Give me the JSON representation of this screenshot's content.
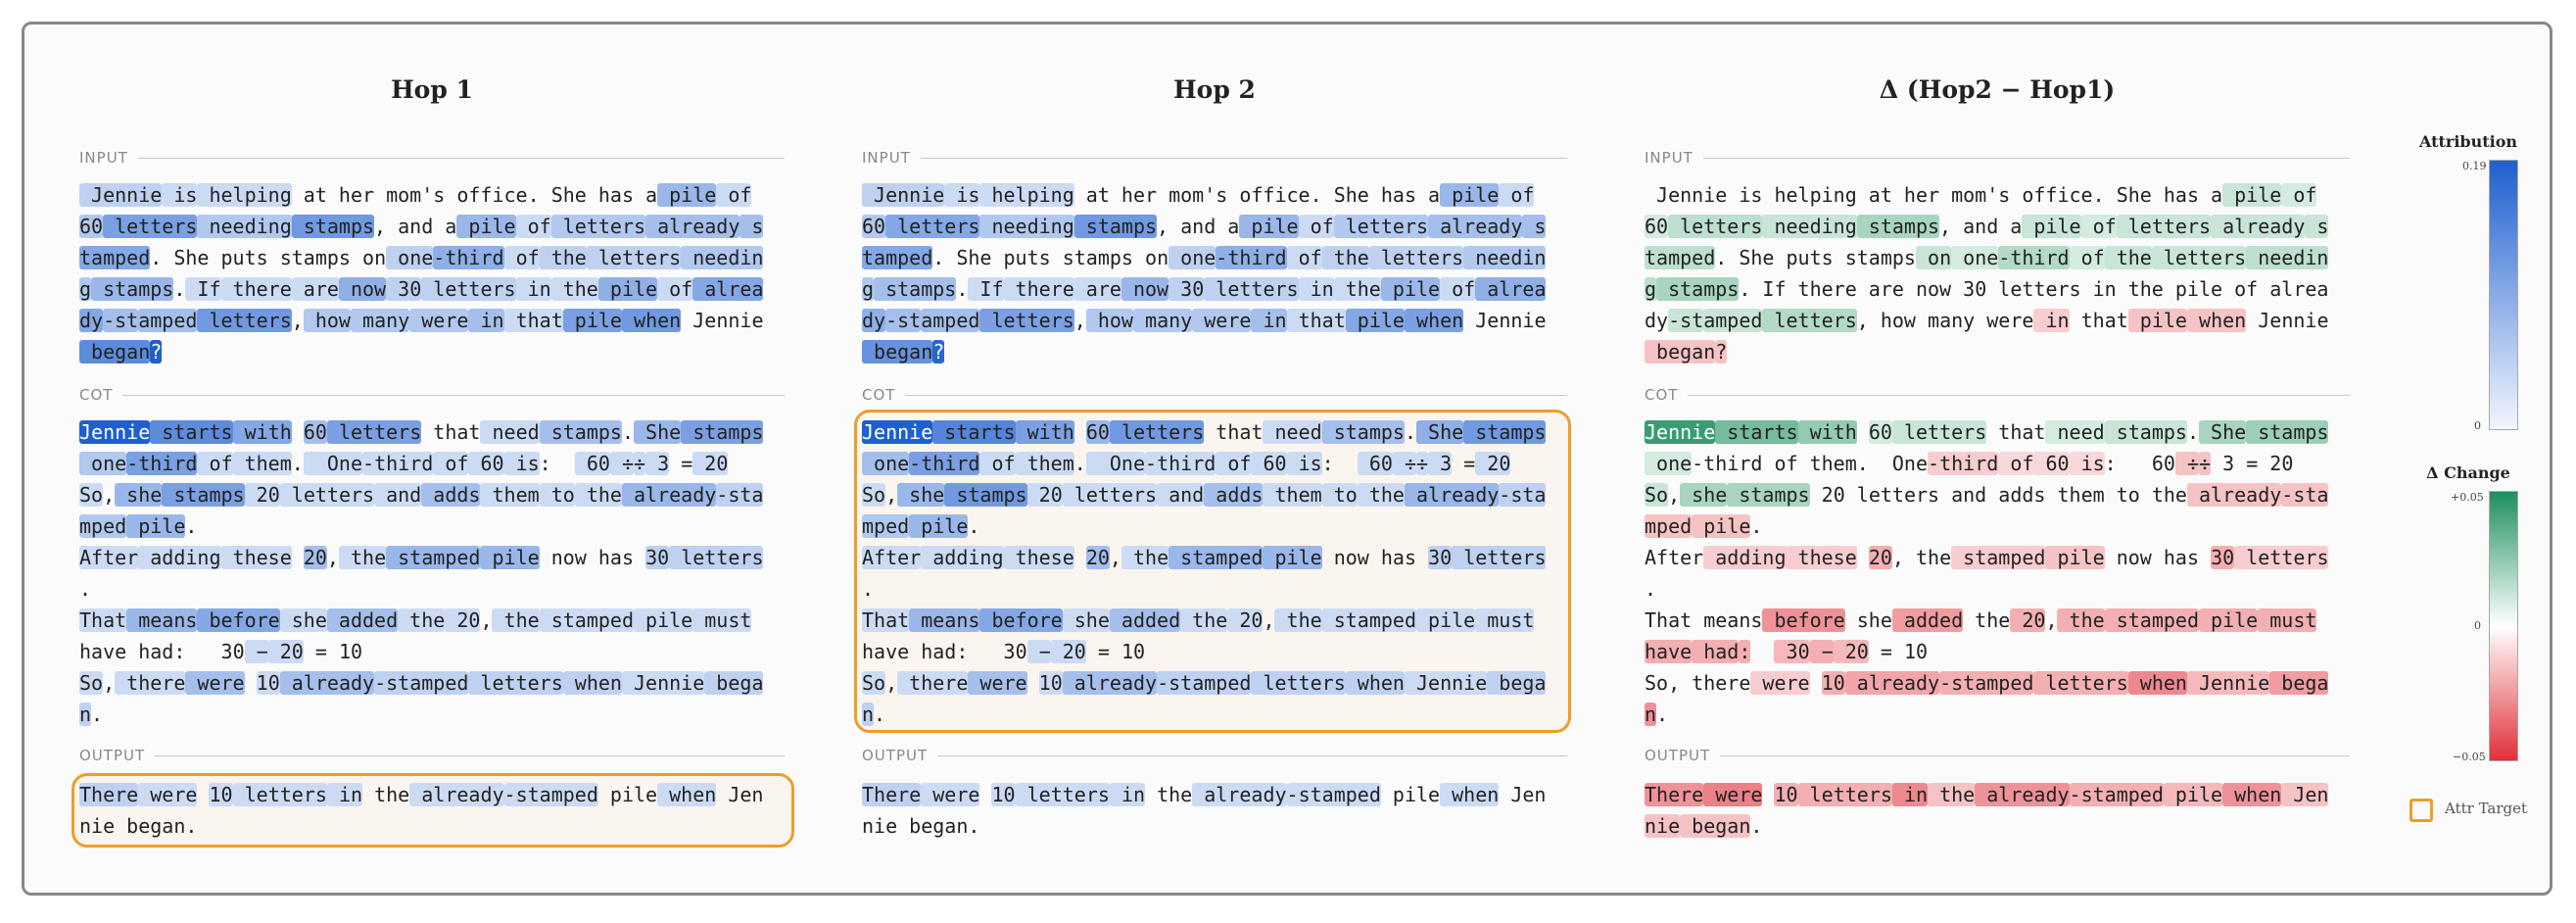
{
  "panels": [
    {
      "title": "Hop 1",
      "mode": "attr",
      "box": "output"
    },
    {
      "title": "Hop 2",
      "mode": "attr",
      "box": "cot"
    },
    {
      "title": "Δ (Hop2 − Hop1)",
      "mode": "delta",
      "box": null
    }
  ],
  "sections": {
    "input": "INPUT",
    "cot": "COT",
    "output": "OUTPUT"
  },
  "legend": {
    "attribution_title": "Attribution",
    "attribution_max": "0.19",
    "attribution_min": "0",
    "change_title": "Δ Change",
    "change_max": "+0.05",
    "change_mid": "0",
    "change_min": "−0.05",
    "target_label": "Attr Target"
  },
  "colors": {
    "attribution": "#1f5fcf",
    "positive": "#1e8f5e",
    "negative": "#e0303a",
    "target": "#ec9e2a"
  },
  "tokens": {
    "input": [
      [
        " Jennie",
        0.03,
        0.03,
        0.0
      ],
      [
        " is",
        0.02,
        0.02,
        0.0
      ],
      [
        " helping",
        0.02,
        0.02,
        0.0
      ],
      [
        " at",
        0.0,
        0.0,
        0.0
      ],
      [
        " her",
        0.0,
        0.0,
        0.0
      ],
      [
        " mom",
        0.0,
        0.0,
        0.0
      ],
      [
        "'s",
        0.0,
        0.0,
        0.0
      ],
      [
        " office",
        0.0,
        0.0,
        0.0
      ],
      [
        ".",
        0.0,
        0.0,
        0.0
      ],
      [
        " She",
        0.0,
        0.0,
        0.0
      ],
      [
        " has",
        0.0,
        0.0,
        0.0
      ],
      [
        " a",
        0.0,
        0.0,
        0.0
      ],
      [
        " pile",
        0.06,
        0.06,
        0.15
      ],
      [
        " of",
        0.02,
        0.02,
        0.1
      ],
      [
        "\n",
        0,
        0,
        0
      ],
      [
        "60",
        0.04,
        0.04,
        0.1
      ],
      [
        " letters",
        0.09,
        0.08,
        0.2
      ],
      [
        " needing",
        0.04,
        0.04,
        0.15
      ],
      [
        " stamps",
        0.1,
        0.1,
        0.3
      ],
      [
        ",",
        0.0,
        0.0,
        0.0
      ],
      [
        " and",
        0.0,
        0.0,
        0.0
      ],
      [
        " a",
        0.0,
        0.0,
        0.0
      ],
      [
        " pile",
        0.06,
        0.06,
        0.15
      ],
      [
        " of",
        0.02,
        0.02,
        0.1
      ],
      [
        " letters",
        0.04,
        0.04,
        0.15
      ],
      [
        " already",
        0.05,
        0.05,
        0.15
      ],
      [
        " s",
        0.05,
        0.05,
        0.15
      ],
      [
        "\n",
        0,
        0,
        0
      ],
      [
        "tamped",
        0.08,
        0.08,
        0.2
      ],
      [
        ".",
        0.0,
        0.0,
        0.0
      ],
      [
        " She",
        0.0,
        0.0,
        0.0
      ],
      [
        " puts",
        0.0,
        0.0,
        0.0
      ],
      [
        " stamps",
        0.0,
        0.0,
        0.0
      ],
      [
        " on",
        0.0,
        0.0,
        0.15
      ],
      [
        " one",
        0.03,
        0.03,
        0.1
      ],
      [
        "-third",
        0.07,
        0.07,
        0.25
      ],
      [
        " of",
        0.02,
        0.02,
        0.1
      ],
      [
        " the",
        0.03,
        0.03,
        0.15
      ],
      [
        " letters",
        0.03,
        0.03,
        0.15
      ],
      [
        " needin",
        0.04,
        0.04,
        0.2
      ],
      [
        "\n",
        0,
        0,
        0
      ],
      [
        "g",
        0.04,
        0.04,
        0.2
      ],
      [
        " stamps",
        0.06,
        0.05,
        0.3
      ],
      [
        ".",
        0.0,
        0.0,
        0.0
      ],
      [
        " If",
        0.02,
        0.02,
        0.0
      ],
      [
        " there",
        0.02,
        0.02,
        0.0
      ],
      [
        " are",
        0.02,
        0.02,
        0.0
      ],
      [
        " now",
        0.07,
        0.06,
        0.0
      ],
      [
        " 30",
        0.03,
        0.03,
        0.0
      ],
      [
        " letters",
        0.03,
        0.03,
        0.0
      ],
      [
        " in",
        0.02,
        0.02,
        0.0
      ],
      [
        " the",
        0.02,
        0.02,
        0.0
      ],
      [
        " pile",
        0.07,
        0.06,
        0.0
      ],
      [
        " of",
        0.02,
        0.02,
        0.0
      ],
      [
        " alrea",
        0.08,
        0.07,
        0.0
      ],
      [
        "\n",
        0,
        0,
        0
      ],
      [
        "dy",
        0.08,
        0.07,
        0.0
      ],
      [
        "-st",
        0.05,
        0.05,
        0.15
      ],
      [
        "amped",
        0.05,
        0.05,
        0.15
      ],
      [
        " letters",
        0.1,
        0.09,
        0.25
      ],
      [
        ",",
        0.0,
        0.0,
        0.0
      ],
      [
        " how",
        0.04,
        0.04,
        0.0
      ],
      [
        " many",
        0.04,
        0.04,
        0.0
      ],
      [
        " were",
        0.04,
        0.04,
        0.0
      ],
      [
        " in",
        0.05,
        0.05,
        -0.15
      ],
      [
        " that",
        0.02,
        0.02,
        0.0
      ],
      [
        " pile",
        0.09,
        0.08,
        -0.2
      ],
      [
        " when",
        0.1,
        0.09,
        -0.2
      ],
      [
        " Jennie",
        0.0,
        0.0,
        0.0
      ],
      [
        "\n",
        0,
        0,
        0
      ],
      [
        " began",
        0.12,
        0.11,
        -0.2
      ],
      [
        "?",
        0.19,
        0.18,
        -0.2
      ]
    ],
    "cot": [
      [
        "Jennie",
        0.19,
        0.19,
        0.85
      ],
      [
        " starts",
        0.12,
        0.13,
        0.55
      ],
      [
        " with",
        0.08,
        0.09,
        0.4
      ],
      [
        " ",
        0.0,
        0.0,
        0.0
      ],
      [
        "60",
        0.05,
        0.06,
        0.1
      ],
      [
        " letters",
        0.09,
        0.1,
        0.15
      ],
      [
        " that",
        0.0,
        0.0,
        0.0
      ],
      [
        " need",
        0.02,
        0.02,
        0.1
      ],
      [
        " stamps",
        0.05,
        0.05,
        0.15
      ],
      [
        ".",
        0.0,
        0.0,
        0.0
      ],
      [
        " She",
        0.06,
        0.07,
        0.3
      ],
      [
        " stamps",
        0.09,
        0.1,
        0.35
      ],
      [
        "\n",
        0,
        0,
        0
      ],
      [
        " one",
        0.04,
        0.05,
        0.1
      ],
      [
        "-third",
        0.09,
        0.09,
        0.0
      ],
      [
        " of",
        0.02,
        0.02,
        0.0
      ],
      [
        " them",
        0.02,
        0.02,
        0.0
      ],
      [
        ".",
        0.0,
        0.0,
        0.0
      ],
      [
        "  One",
        0.02,
        0.02,
        0.0
      ],
      [
        "-third",
        0.02,
        0.02,
        -0.15
      ],
      [
        " of",
        0.02,
        0.02,
        -0.1
      ],
      [
        " 60",
        0.02,
        0.02,
        -0.1
      ],
      [
        " is",
        0.02,
        0.02,
        -0.1
      ],
      [
        ":",
        0.0,
        0.0,
        0.0
      ],
      [
        "  ",
        0.0,
        0.0,
        0.0
      ],
      [
        " 60",
        0.02,
        0.02,
        0.0
      ],
      [
        " ÷",
        0.02,
        0.02,
        -0.2
      ],
      [
        "÷",
        0.02,
        0.02,
        -0.2
      ],
      [
        " 3",
        0.02,
        0.02,
        0.0
      ],
      [
        " =",
        0.0,
        0.0,
        0.0
      ],
      [
        " 20",
        0.02,
        0.02,
        0.0
      ],
      [
        "\n",
        0,
        0,
        0
      ],
      [
        "So",
        0.02,
        0.02,
        0.15
      ],
      [
        ",",
        0.0,
        0.0,
        0.0
      ],
      [
        " she",
        0.06,
        0.06,
        0.3
      ],
      [
        " stamps",
        0.09,
        0.1,
        0.3
      ],
      [
        " 20",
        0.02,
        0.02,
        0.0
      ],
      [
        " letters",
        0.02,
        0.02,
        0.0
      ],
      [
        " and",
        0.02,
        0.02,
        0.0
      ],
      [
        " adds",
        0.05,
        0.05,
        0.0
      ],
      [
        " them",
        0.02,
        0.02,
        0.0
      ],
      [
        " to",
        0.02,
        0.02,
        0.0
      ],
      [
        " the",
        0.02,
        0.02,
        0.0
      ],
      [
        " already",
        0.06,
        0.06,
        -0.2
      ],
      [
        "-sta",
        0.03,
        0.03,
        -0.2
      ],
      [
        "\n",
        0,
        0,
        0
      ],
      [
        "mped",
        0.04,
        0.04,
        -0.2
      ],
      [
        " pile",
        0.06,
        0.06,
        -0.2
      ],
      [
        ".",
        0.0,
        0.0,
        0.0
      ],
      [
        "\n",
        0,
        0,
        0
      ],
      [
        "After",
        0.02,
        0.02,
        0.0
      ],
      [
        " adding",
        0.02,
        0.02,
        -0.15
      ],
      [
        " these",
        0.02,
        0.02,
        -0.15
      ],
      [
        " ",
        0.0,
        0.0,
        0.0
      ],
      [
        "20",
        0.05,
        0.05,
        -0.3
      ],
      [
        ",",
        0.0,
        0.0,
        0.0
      ],
      [
        " the",
        0.02,
        0.02,
        0.0
      ],
      [
        " stamped",
        0.06,
        0.06,
        -0.15
      ],
      [
        " pile",
        0.06,
        0.06,
        -0.2
      ],
      [
        " now",
        0.0,
        0.0,
        0.0
      ],
      [
        " has",
        0.0,
        0.0,
        0.0
      ],
      [
        " ",
        0.0,
        0.0,
        0.0
      ],
      [
        "30",
        0.03,
        0.03,
        -0.3
      ],
      [
        " letters",
        0.03,
        0.03,
        -0.15
      ],
      [
        "\n",
        0,
        0,
        0
      ],
      [
        ".",
        0.0,
        0.0,
        0.0
      ],
      [
        "\n",
        0,
        0,
        0
      ],
      [
        "That",
        0.02,
        0.02,
        0.0
      ],
      [
        " means",
        0.06,
        0.06,
        0.0
      ],
      [
        " before",
        0.08,
        0.08,
        -0.45
      ],
      [
        " she",
        0.02,
        0.02,
        0.0
      ],
      [
        " added",
        0.05,
        0.05,
        -0.4
      ],
      [
        " the",
        0.02,
        0.02,
        0.0
      ],
      [
        " 20",
        0.02,
        0.02,
        -0.3
      ],
      [
        ",",
        0.0,
        0.0,
        0.0
      ],
      [
        " the",
        0.02,
        0.02,
        -0.3
      ],
      [
        " stamped",
        0.02,
        0.02,
        -0.3
      ],
      [
        " pile",
        0.02,
        0.02,
        -0.3
      ],
      [
        " must",
        0.02,
        0.02,
        -0.3
      ],
      [
        "\n",
        0,
        0,
        0
      ],
      [
        "have",
        0.0,
        0.0,
        -0.3
      ],
      [
        " had",
        0.0,
        0.0,
        -0.3
      ],
      [
        ":",
        0.0,
        0.0,
        -0.3
      ],
      [
        "  ",
        0.0,
        0.0,
        0.0
      ],
      [
        " 30",
        0.0,
        0.0,
        -0.25
      ],
      [
        " −",
        0.02,
        0.02,
        -0.3
      ],
      [
        " 20",
        0.02,
        0.02,
        -0.25
      ],
      [
        " =",
        0.0,
        0.0,
        0.0
      ],
      [
        " 10",
        0.0,
        0.0,
        0.0
      ],
      [
        "\n",
        0,
        0,
        0
      ],
      [
        "So",
        0.02,
        0.02,
        0.0
      ],
      [
        ",",
        0.0,
        0.0,
        0.0
      ],
      [
        " there",
        0.02,
        0.02,
        0.0
      ],
      [
        " were",
        0.05,
        0.05,
        -0.15
      ],
      [
        " ",
        0.0,
        0.0,
        0.0
      ],
      [
        "10",
        0.02,
        0.02,
        -0.3
      ],
      [
        " already",
        0.05,
        0.05,
        -0.35
      ],
      [
        "-stamped",
        0.03,
        0.03,
        -0.3
      ],
      [
        " letters",
        0.03,
        0.03,
        -0.3
      ],
      [
        " when",
        0.03,
        0.03,
        -0.5
      ],
      [
        " Jennie",
        0.02,
        0.02,
        -0.25
      ],
      [
        " bega",
        0.03,
        0.03,
        -0.4
      ],
      [
        "\n",
        0,
        0,
        0
      ],
      [
        "n",
        0.03,
        0.03,
        -0.45
      ],
      [
        ".",
        0.0,
        0.0,
        0.0
      ]
    ],
    "output": [
      [
        "There",
        0.03,
        0.03,
        -0.45
      ],
      [
        " were",
        0.02,
        0.02,
        -0.55
      ],
      [
        " ",
        0.0,
        0.0,
        0.0
      ],
      [
        "10",
        0.02,
        0.02,
        -0.3
      ],
      [
        " letters",
        0.02,
        0.02,
        -0.3
      ],
      [
        " in",
        0.02,
        0.02,
        -0.5
      ],
      [
        " the",
        0.0,
        0.0,
        -0.2
      ],
      [
        " already",
        0.02,
        0.02,
        -0.45
      ],
      [
        "-stamped",
        0.02,
        0.02,
        -0.3
      ],
      [
        " pile",
        0.0,
        0.0,
        -0.25
      ],
      [
        " when",
        0.02,
        0.02,
        -0.45
      ],
      [
        " Jen",
        0.0,
        0.0,
        -0.2
      ],
      [
        "\n",
        0,
        0,
        0
      ],
      [
        "nie",
        0.0,
        0.0,
        -0.2
      ],
      [
        " began",
        0.0,
        0.0,
        -0.2
      ],
      [
        ".",
        0.0,
        0.0,
        0.0
      ]
    ]
  }
}
